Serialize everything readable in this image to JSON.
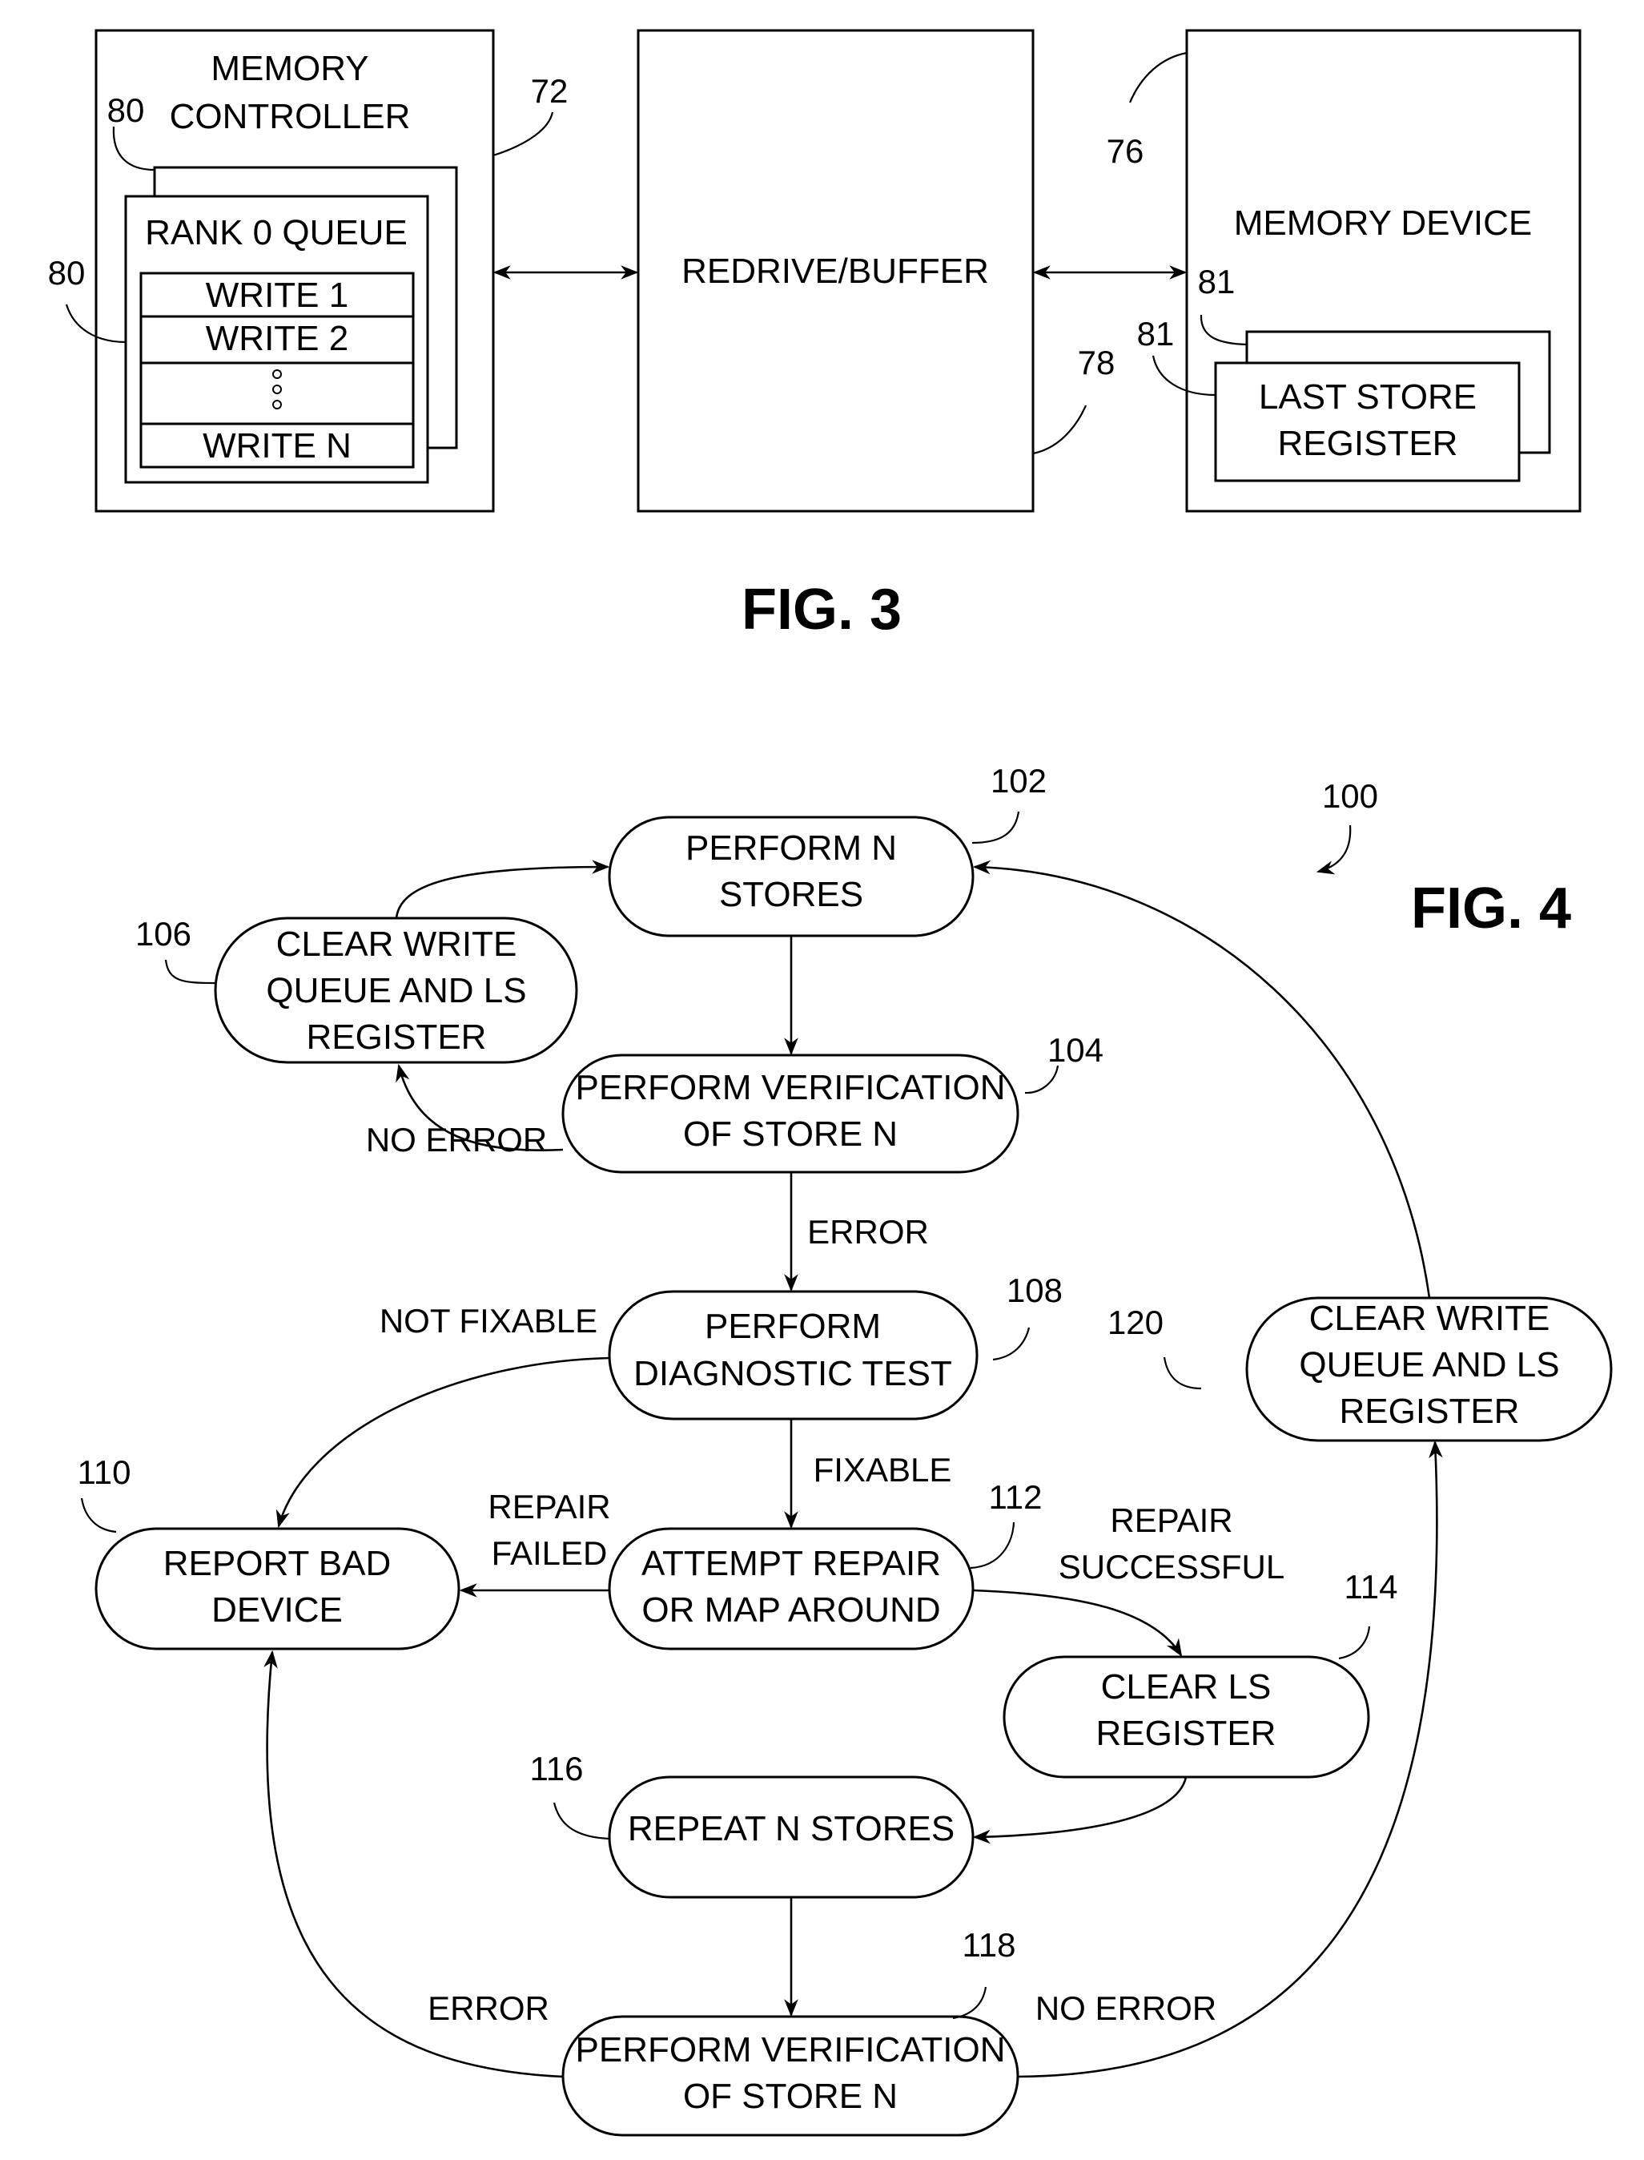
{
  "fig3": {
    "caption": "FIG. 3",
    "memory_controller": {
      "title_line1": "MEMORY",
      "title_line2": "CONTROLLER",
      "ref": "72",
      "queue": {
        "title": "RANK 0 QUEUE",
        "ref_back": "80",
        "ref_front": "80",
        "entries": [
          "WRITE 1",
          "WRITE 2",
          "",
          "WRITE N"
        ]
      }
    },
    "redrive": {
      "label": "REDRIVE/BUFFER",
      "ref": "78"
    },
    "memory_device": {
      "label": "MEMORY DEVICE",
      "ref": "76",
      "register": {
        "line1": "LAST STORE",
        "line2": "REGISTER",
        "ref_back": "81",
        "ref_front": "81"
      }
    }
  },
  "fig4": {
    "caption": "FIG. 4",
    "ref": "100",
    "nodes": {
      "perform_stores": {
        "ref": "102",
        "lines": [
          "PERFORM N",
          "STORES"
        ]
      },
      "verify_1": {
        "ref": "104",
        "lines": [
          "PERFORM VERIFICATION",
          "OF STORE N"
        ]
      },
      "clear_queue_1": {
        "ref": "106",
        "lines": [
          "CLEAR WRITE",
          "QUEUE AND LS",
          "REGISTER"
        ]
      },
      "diagnostic": {
        "ref": "108",
        "lines": [
          "PERFORM",
          "DIAGNOSTIC TEST"
        ]
      },
      "report_bad": {
        "ref": "110",
        "lines": [
          "REPORT BAD",
          "DEVICE"
        ]
      },
      "attempt_repair": {
        "ref": "112",
        "lines": [
          "ATTEMPT REPAIR",
          "OR MAP AROUND"
        ]
      },
      "clear_ls": {
        "ref": "114",
        "lines": [
          "CLEAR LS",
          "REGISTER"
        ]
      },
      "repeat_stores": {
        "ref": "116",
        "lines": [
          "REPEAT N STORES"
        ]
      },
      "verify_2": {
        "ref": "118",
        "lines": [
          "PERFORM VERIFICATION",
          "OF STORE N"
        ]
      },
      "clear_queue_2": {
        "ref": "120",
        "lines": [
          "CLEAR WRITE",
          "QUEUE AND LS",
          "REGISTER"
        ]
      }
    },
    "edge_labels": {
      "no_error_1": "NO ERROR",
      "error_1": "ERROR",
      "not_fixable": "NOT FIXABLE",
      "fixable": "FIXABLE",
      "repair_failed": [
        "REPAIR",
        "FAILED"
      ],
      "repair_successful": [
        "REPAIR",
        "SUCCESSFUL"
      ],
      "error_2": "ERROR",
      "no_error_2": "NO ERROR"
    }
  }
}
